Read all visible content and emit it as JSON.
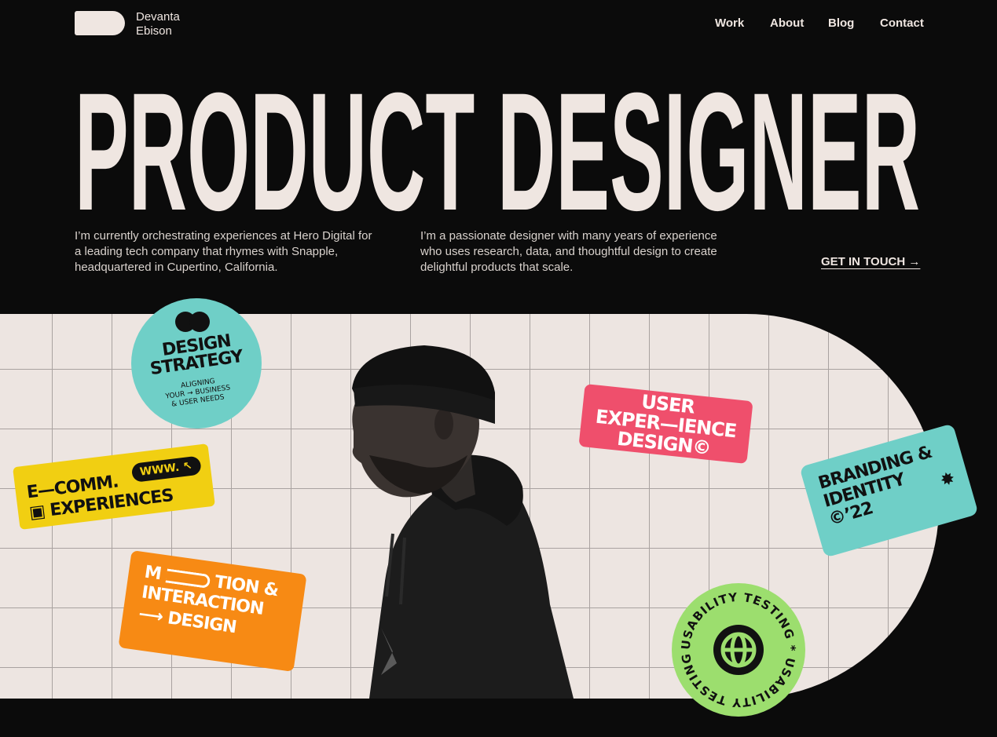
{
  "header": {
    "logo_name_line1": "Devanta",
    "logo_name_line2": "Ebison",
    "nav": [
      "Work",
      "About",
      "Blog",
      "Contact"
    ]
  },
  "hero": {
    "title": "PRODUCT DESIGNER",
    "intro_left": "I’m currently orchestrating experiences at Hero Digital for a leading tech company that rhymes with Snapple, headquartered in Cupertino, California.",
    "intro_right": "I’m a passionate designer with many years of experience who uses research, data, and thoughtful design to create delightful products that scale.",
    "cta": "GET IN TOUCH  →"
  },
  "stickers": {
    "strategy": {
      "line1": "DESIGN",
      "line2": "STRATEGY",
      "small1": "ALIGNING",
      "small2": "YOUR → BUSINESS",
      "small3": "& USER NEEDS"
    },
    "ecomm": {
      "line1": "E—COMM.",
      "pill": "WWW.",
      "line2": "EXPERIENCES"
    },
    "motion": {
      "line1": "M",
      "line1b": "TION &",
      "line2": "INTERACTION",
      "line3": "DESIGN"
    },
    "ux": {
      "line1": "USER",
      "line2": "EXPER—IENCE",
      "line3": "DESIGN©"
    },
    "brand": {
      "line1": "BRANDING &",
      "line2": "IDENTITY",
      "line3": "©’22",
      "star": "✸"
    },
    "usability": {
      "ring_text": "USABILITY TESTING * USABILITY TESTING *"
    }
  },
  "colors": {
    "background": "#0b0b0b",
    "cream": "#efe6e1",
    "teal": "#6fcfc7",
    "yellow": "#f1cf12",
    "orange": "#f78a14",
    "pink": "#ef4f6c",
    "green": "#9cde6e"
  }
}
